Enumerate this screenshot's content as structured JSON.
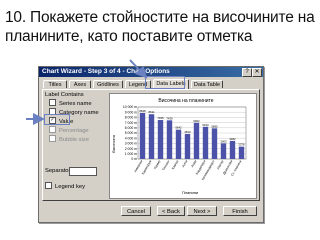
{
  "slide": {
    "title": "10. Покажете стойностите на височините на планините, като поставите отметка"
  },
  "dialog": {
    "title": "Chart Wizard - Step 3 of 4 - Chart Options",
    "help_label": "?",
    "close_label": "✕",
    "tabs": [
      "Titles",
      "Axes",
      "Gridlines",
      "Legend",
      "Data Labels",
      "Data Table"
    ],
    "active_tab": "Data Labels",
    "group_label": "Label Contains",
    "options": [
      {
        "label": "Series name",
        "checked": false,
        "enabled": true
      },
      {
        "label": "Category name",
        "checked": false,
        "enabled": true
      },
      {
        "label": "Value",
        "checked": true,
        "enabled": true
      },
      {
        "label": "Percentage",
        "checked": false,
        "enabled": false
      },
      {
        "label": "Bubble size",
        "checked": false,
        "enabled": false
      }
    ],
    "separator_label": "Separator:",
    "legend_key_label": "Legend key",
    "buttons": {
      "cancel": "Cancel",
      "back": "< Back",
      "next": "Next >",
      "finish": "Finish"
    }
  },
  "chart_data": {
    "type": "bar",
    "title": "Височина на планините",
    "xlabel": "Планини",
    "ylabel": "Височина",
    "ylim": [
      0,
      10000
    ],
    "yticks": [
      "10 000 m",
      "9 000 m",
      "8 000 m",
      "7 000 m",
      "6 000 m",
      "5 000 m",
      "4 000 m",
      "3 000 m",
      "2 000 m",
      "1 000 m",
      "0 m"
    ],
    "categories": [
      "Хималаи",
      "Каракорум",
      "Памир",
      "Тяншан",
      "Кавказ",
      "Алпи",
      "Анди",
      "Кордилери",
      "Килиманджаро",
      "Ахагар",
      "Драконови",
      "Ст. планина"
    ],
    "values": [
      8848,
      8611,
      7495,
      7439,
      5642,
      4810,
      6962,
      6194,
      5895,
      3003,
      3482,
      2376
    ],
    "color": "#4b52a8"
  },
  "colors": {
    "accent": "#6a80c0",
    "titlebar": "#0a246a"
  }
}
